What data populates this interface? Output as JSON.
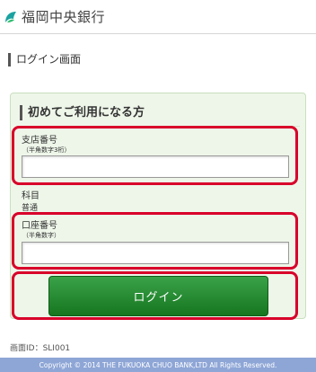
{
  "header": {
    "bank_name": "福岡中央銀行",
    "logo_icon": "bank-logo-icon",
    "logo_color": "#1aa3a0"
  },
  "page": {
    "heading": "ログイン画面"
  },
  "login_panel": {
    "title": "初めてご利用になる方",
    "branch": {
      "label": "支店番号",
      "hint": "（半角数字3桁）",
      "value": "",
      "placeholder": ""
    },
    "subject": {
      "label": "科目",
      "value": "普通"
    },
    "account": {
      "label": "口座番号",
      "hint": "（半角数字）",
      "value": "",
      "placeholder": ""
    },
    "login_button": "ログイン"
  },
  "screen_id": "画面ID：SLI001",
  "footer": {
    "copyright": "Copyright © 2014 THE FUKUOKA CHUO BANK,LTD All Rights Reserved."
  },
  "colors": {
    "highlight": "#d8002a",
    "button_top": "#3aa24a",
    "button_bottom": "#16761f",
    "panel_bg": "#eef6e9",
    "footer_bg": "#8ea6d6"
  }
}
